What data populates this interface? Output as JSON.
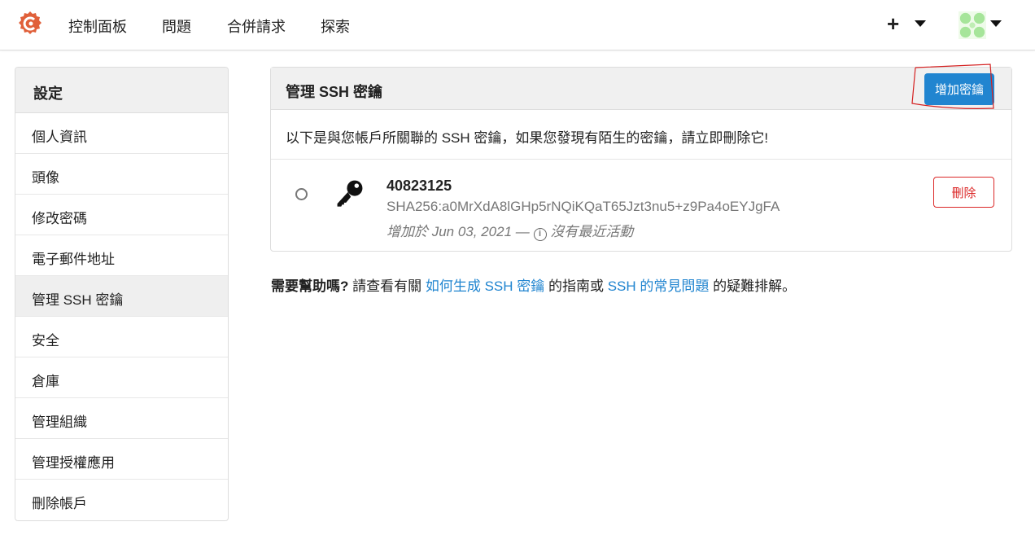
{
  "nav": {
    "items": [
      "控制面板",
      "問題",
      "合併請求",
      "探索"
    ],
    "plus": "+"
  },
  "sidebar": {
    "title": "設定",
    "items": [
      "個人資訊",
      "頭像",
      "修改密碼",
      "電子郵件地址",
      "管理 SSH 密鑰",
      "安全",
      "倉庫",
      "管理組織",
      "管理授權應用",
      "刪除帳戶"
    ],
    "active_index": 4
  },
  "panel": {
    "title": "管理 SSH 密鑰",
    "add_button": "增加密鑰",
    "intro": "以下是與您帳戶所關聯的 SSH 密鑰，如果您發現有陌生的密鑰，請立即刪除它!"
  },
  "key": {
    "name": "40823125",
    "fingerprint": "SHA256:a0MrXdA8lGHp5rNQiKQaT65Jzt3nu5+z9Pa4oEYJgFA",
    "added": "增加於 Jun 03, 2021 —",
    "activity": "沒有最近活動",
    "delete_button": "刪除"
  },
  "help": {
    "bold": "需要幫助嗎?",
    "text1": " 請查看有關 ",
    "link1": "如何生成 SSH 密鑰",
    "text2": " 的指南或 ",
    "link2": "SSH 的常見問題",
    "text3": " 的疑難排解。"
  },
  "colors": {
    "primary": "#2185d0",
    "danger": "#db2828",
    "logo": "#e0603a"
  }
}
